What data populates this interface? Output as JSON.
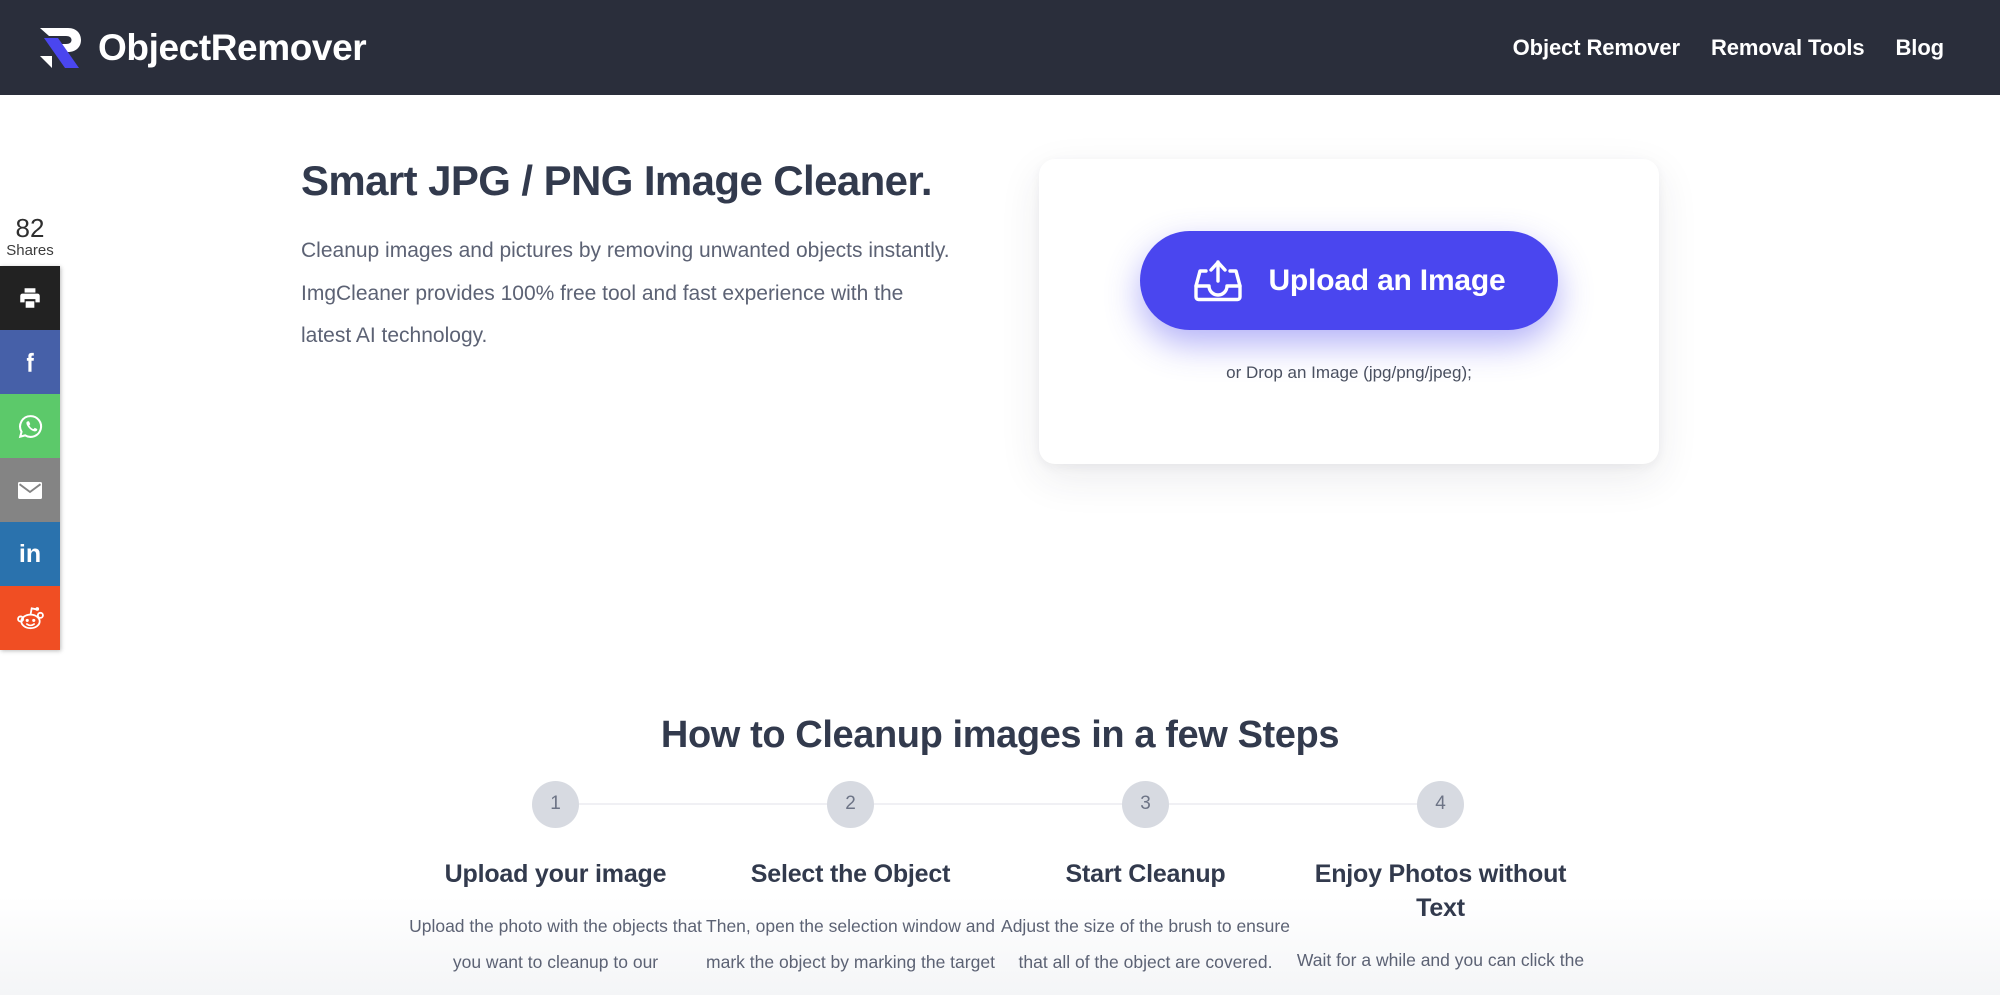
{
  "header": {
    "brand_name": "ObjectRemover",
    "logo_icon": "objectremover-r-logo-icon",
    "nav": [
      {
        "label": "Object Remover",
        "name": "nav-object-remover"
      },
      {
        "label": "Removal Tools",
        "name": "nav-removal-tools"
      },
      {
        "label": "Blog",
        "name": "nav-blog"
      }
    ],
    "colors": {
      "background": "#2a2e3b",
      "text": "#ffffff"
    }
  },
  "share_rail": {
    "count": "82",
    "count_label": "Shares",
    "buttons": [
      {
        "name": "print-icon",
        "label": "Print",
        "color": "#222222"
      },
      {
        "name": "facebook-icon",
        "label": "Facebook",
        "color": "#4660a8"
      },
      {
        "name": "whatsapp-icon",
        "label": "WhatsApp",
        "color": "#5cc96a"
      },
      {
        "name": "email-icon",
        "label": "Email",
        "color": "#848484"
      },
      {
        "name": "linkedin-icon",
        "label": "LinkedIn",
        "color": "#2a72ad"
      },
      {
        "name": "reddit-icon",
        "label": "Reddit",
        "color": "#f04e23"
      }
    ]
  },
  "hero": {
    "title": "Smart JPG / PNG Image Cleaner.",
    "subtitle": "Cleanup images and pictures by removing unwanted objects instantly. ImgCleaner provides 100% free tool and fast experience with the latest AI technology.",
    "upload": {
      "button_label": "Upload an Image",
      "button_icon": "upload-tray-icon",
      "drop_hint": "or Drop an Image (jpg/png/jpeg);",
      "button_color": "#4a46ef"
    }
  },
  "steps_section": {
    "title": "How to Cleanup images in a few Steps",
    "steps": [
      {
        "number": "1",
        "heading": "Upload your image",
        "body": "Upload the photo with the objects that you want to cleanup to our"
      },
      {
        "number": "2",
        "heading": "Select the Object",
        "body": "Then, open the selection window and mark the object by marking the target"
      },
      {
        "number": "3",
        "heading": "Start Cleanup",
        "body": "Adjust the size of the brush to ensure that all of the object are covered."
      },
      {
        "number": "4",
        "heading": "Enjoy Photos without Text",
        "body": "Wait for a while and you can click the"
      }
    ]
  },
  "theme": {
    "page_background": "#ffffff",
    "heading_color": "#323a4d",
    "body_text_color": "#5c6274",
    "accent": "#4a46ef"
  }
}
